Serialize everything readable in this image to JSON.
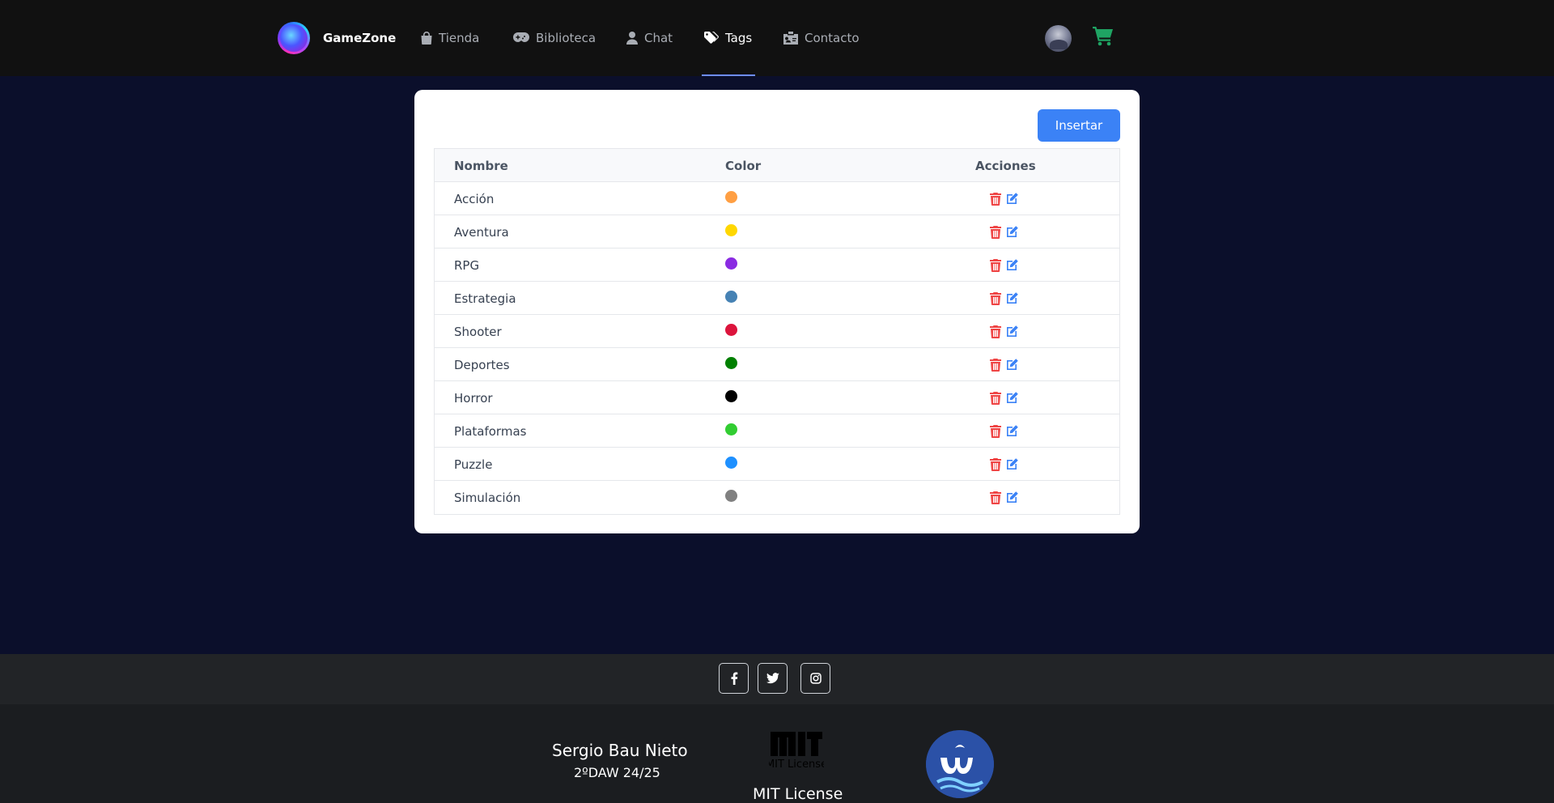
{
  "brand": {
    "name": "GameZone"
  },
  "nav": {
    "items": [
      {
        "label": "Tienda",
        "icon": "shopping-bag-icon"
      },
      {
        "label": "Biblioteca",
        "icon": "gamepad-icon"
      },
      {
        "label": "Chat",
        "icon": "user-icon"
      },
      {
        "label": "Tags",
        "icon": "tags-icon",
        "active": true
      },
      {
        "label": "Contacto",
        "icon": "contact-card-icon"
      }
    ]
  },
  "user": {
    "avatar": "user-avatar",
    "cart_icon": "cart-icon"
  },
  "toolbar": {
    "insert_label": "Insertar"
  },
  "table": {
    "headers": {
      "name": "Nombre",
      "color": "Color",
      "actions": "Acciones"
    },
    "rows": [
      {
        "name": "Acción",
        "color": "#ff9f43"
      },
      {
        "name": "Aventura",
        "color": "#ffd700"
      },
      {
        "name": "RPG",
        "color": "#8a2be2"
      },
      {
        "name": "Estrategia",
        "color": "#4682b4"
      },
      {
        "name": "Shooter",
        "color": "#dc143c"
      },
      {
        "name": "Deportes",
        "color": "#008000"
      },
      {
        "name": "Horror",
        "color": "#000000"
      },
      {
        "name": "Plataformas",
        "color": "#32cd32"
      },
      {
        "name": "Puzzle",
        "color": "#1e90ff"
      },
      {
        "name": "Simulación",
        "color": "#808080"
      }
    ],
    "row_actions": {
      "delete_icon": "trash-icon",
      "edit_icon": "edit-icon"
    }
  },
  "footer": {
    "social": [
      "facebook-icon",
      "twitter-icon",
      "instagram-icon"
    ],
    "author": "Sergio Bau Nieto",
    "course": "2ºDAW 24/25",
    "mit_logo_text": "MIT License",
    "license": "MIT License"
  },
  "colors": {
    "nav_bg": "#111111",
    "page_bg": "#0b0f2b",
    "accent": "#3b82f6",
    "cart": "#1fa463",
    "delete": "#ef4444",
    "edit": "#3b82f6"
  }
}
